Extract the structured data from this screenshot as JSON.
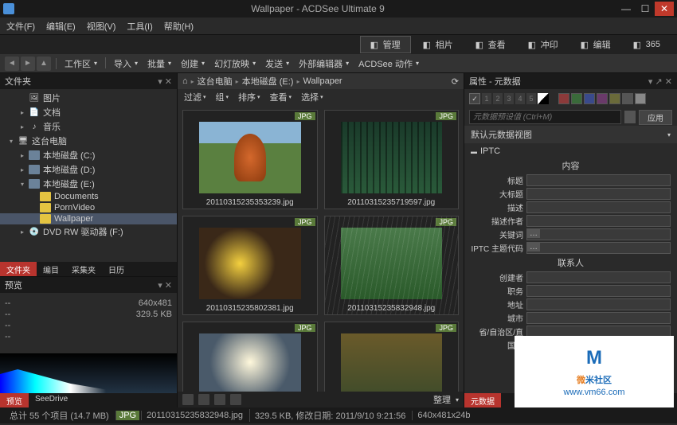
{
  "window": {
    "title": "Wallpaper - ACDSee Ultimate 9"
  },
  "menu": [
    "文件(F)",
    "编辑(E)",
    "视图(V)",
    "工具(I)",
    "帮助(H)"
  ],
  "modes": [
    {
      "label": "管理",
      "active": true
    },
    {
      "label": "相片",
      "active": false
    },
    {
      "label": "查看",
      "active": false
    },
    {
      "label": "冲印",
      "active": false
    },
    {
      "label": "编辑",
      "active": false
    },
    {
      "label": "365",
      "active": false
    }
  ],
  "actions": [
    "工作区",
    "导入",
    "批量",
    "创建",
    "幻灯放映",
    "发送",
    "外部编辑器",
    "ACDSee 动作"
  ],
  "left": {
    "header": "文件夹",
    "tree": [
      {
        "indent": 1,
        "icon": "image",
        "label": "图片",
        "expand": ""
      },
      {
        "indent": 1,
        "icon": "doc",
        "label": "文档",
        "expand": "▸"
      },
      {
        "indent": 1,
        "icon": "music",
        "label": "音乐",
        "expand": "▸"
      },
      {
        "indent": 0,
        "icon": "pc",
        "label": "这台电脑",
        "expand": "▾"
      },
      {
        "indent": 1,
        "icon": "disk",
        "label": "本地磁盘 (C:)",
        "expand": "▸"
      },
      {
        "indent": 1,
        "icon": "disk",
        "label": "本地磁盘 (D:)",
        "expand": "▸"
      },
      {
        "indent": 1,
        "icon": "disk",
        "label": "本地磁盘 (E:)",
        "expand": "▾"
      },
      {
        "indent": 2,
        "icon": "folder",
        "label": "Documents",
        "expand": ""
      },
      {
        "indent": 2,
        "icon": "folder",
        "label": "PornVideo",
        "expand": ""
      },
      {
        "indent": 2,
        "icon": "folder",
        "label": "Wallpaper",
        "expand": "",
        "selected": true
      },
      {
        "indent": 1,
        "icon": "dvd",
        "label": "DVD RW 驱动器 (F:)",
        "expand": "▸"
      }
    ],
    "tabs": [
      "文件夹",
      "编目",
      "采集夹",
      "日历"
    ],
    "preview": {
      "header": "预览",
      "rows": [
        {
          "k": "--",
          "v": "640x481"
        },
        {
          "k": "--",
          "v": "329.5 KB"
        },
        {
          "k": "--",
          "v": ""
        },
        {
          "k": "--",
          "v": ""
        }
      ]
    },
    "bottom_tabs": [
      "预览",
      "SeeDrive"
    ]
  },
  "center": {
    "breadcrumb": [
      "这台电脑",
      "本地磁盘 (E:)",
      "Wallpaper"
    ],
    "filters": [
      "过滤",
      "组",
      "排序",
      "查看",
      "选择"
    ],
    "thumbs": [
      {
        "badge": "JPG",
        "name": "20110315235353239.jpg",
        "cls": "img1"
      },
      {
        "badge": "JPG",
        "name": "20110315235719597.jpg",
        "cls": "img2"
      },
      {
        "badge": "JPG",
        "name": "20110315235802381.jpg",
        "cls": "img3"
      },
      {
        "badge": "JPG",
        "name": "20110315235832948.jpg",
        "cls": "img4"
      },
      {
        "badge": "JPG",
        "name": "",
        "cls": "img5"
      },
      {
        "badge": "JPG",
        "name": "",
        "cls": "img6"
      }
    ],
    "toolbar_right": "整理"
  },
  "right": {
    "header": "属性 - 元数据",
    "ratings": [
      "1",
      "2",
      "3",
      "4",
      "5"
    ],
    "swatches": [
      "#8b3a3a",
      "#3a6a3a",
      "#3a4a8b",
      "#6a3a6a",
      "#6a6a3a",
      "#555",
      "#888"
    ],
    "preset_placeholder": "元数据预设值 (Ctrl+M)",
    "apply": "应用",
    "view_label": "默认元数据视图",
    "section": "IPTC",
    "sub1": "内容",
    "fields1": [
      "标题",
      "大标题",
      "描述",
      "描述作者",
      "关键词",
      "IPTC 主题代码"
    ],
    "sub2": "联系人",
    "fields2": [
      "创建者",
      "职务",
      "地址",
      "城市",
      "省/自治区/直",
      "国家"
    ],
    "tabs": [
      "元数据"
    ]
  },
  "status": {
    "total": "总计 55 个项目  (14.7 MB)",
    "badge": "JPG",
    "file": "20110315235832948.jpg",
    "size": "329.5 KB, 修改日期: 2011/9/10 9:21:56",
    "dim": "640x481x24b"
  },
  "watermark": {
    "text1": "微",
    "text2": "米社区",
    "url": "www.vm66.com"
  }
}
